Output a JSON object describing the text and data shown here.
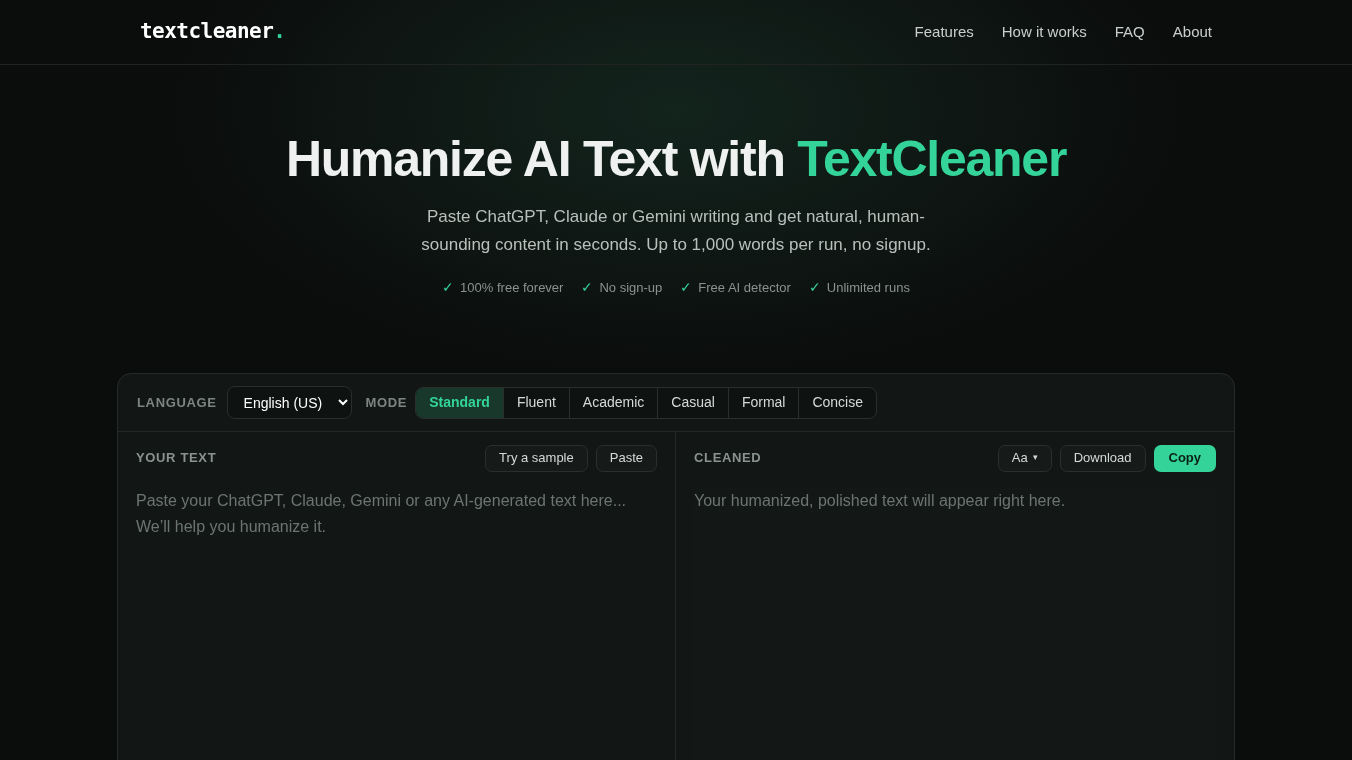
{
  "header": {
    "logo": "textcleaner",
    "logo_dot": ".",
    "nav": [
      "Features",
      "How it works",
      "FAQ",
      "About"
    ]
  },
  "hero": {
    "title": "Humanize AI Text with",
    "title_accent": "TextCleaner",
    "subtitle": "Paste ChatGPT, Claude or Gemini writing and get natural, human-sounding content in seconds. Up to 1,000 words per run, no signup.",
    "perks": [
      {
        "check": "✓",
        "label": "100% free forever"
      },
      {
        "check": "✓",
        "label": "No sign-up"
      },
      {
        "check": "✓",
        "label": "Free AI detector"
      },
      {
        "check": "✓",
        "label": "Unlimited runs"
      }
    ]
  },
  "toolbar": {
    "language_label": "LANGUAGE",
    "language": "English (US)",
    "mode_label": "MODE",
    "modes": [
      {
        "label": "Standard",
        "selected": true
      },
      {
        "label": "Fluent",
        "selected": false
      },
      {
        "label": "Academic",
        "selected": false
      },
      {
        "label": "Casual",
        "selected": false
      },
      {
        "label": "Formal",
        "selected": false
      },
      {
        "label": "Concise",
        "selected": false
      }
    ]
  },
  "input_panel": {
    "heading": "YOUR TEXT",
    "buttons": [
      "Try a sample",
      "Paste"
    ],
    "placeholder": "Paste your ChatGPT, Claude, Gemini or any AI-generated text here... We’ll help you humanize it."
  },
  "output_panel": {
    "heading": "CLEANED",
    "font_button": "Aa",
    "font_caret": "▾",
    "download": "Download",
    "copy": "Copy",
    "placeholder": "Your humanized, polished text will appear right here."
  }
}
